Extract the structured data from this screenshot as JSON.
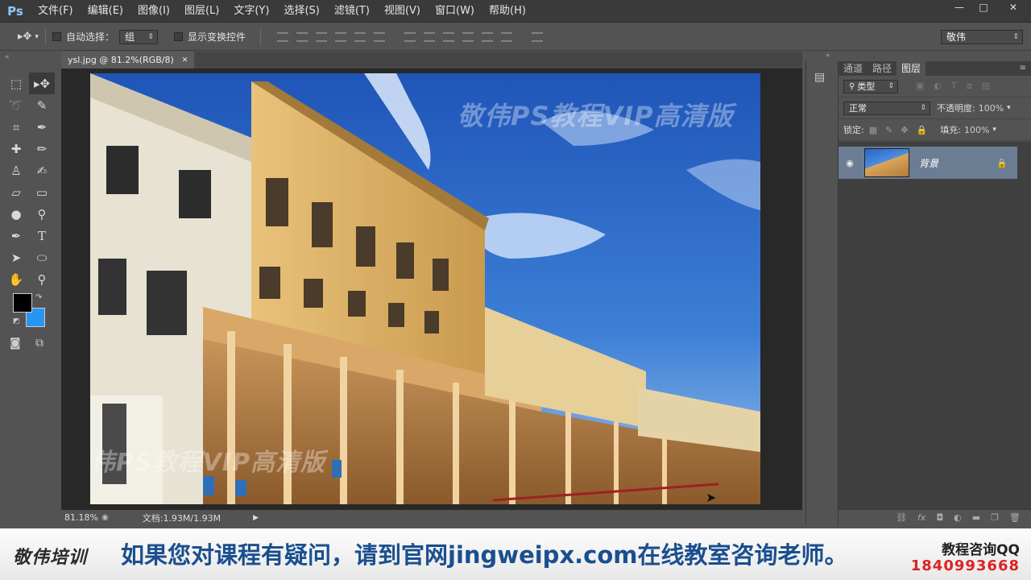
{
  "app": {
    "logo": "Ps"
  },
  "menu": [
    "文件(F)",
    "编辑(E)",
    "图像(I)",
    "图层(L)",
    "文字(Y)",
    "选择(S)",
    "滤镜(T)",
    "视图(V)",
    "窗口(W)",
    "帮助(H)"
  ],
  "window_controls": {
    "minimize": "—",
    "maximize": "□",
    "close": "✕"
  },
  "options": {
    "auto_select_label": "自动选择：",
    "auto_select_value": "组",
    "show_transform_label": "显示变换控件",
    "workspace": "敬伟"
  },
  "document": {
    "tab_title": "ysl.jpg @ 81.2%(RGB/8)",
    "close_glyph": "✕",
    "zoom": "81.18%",
    "doc_size": "文档:1.93M/1.93M",
    "watermark_top": "敬伟PS教程VIP高清版",
    "watermark_bottom": "敬伟PS教程VIP高清版"
  },
  "layers_panel": {
    "tabs": [
      "通道",
      "路径",
      "图层"
    ],
    "filter_kind": "类型",
    "blend_mode": "正常",
    "opacity_label": "不透明度:",
    "opacity_value": "100%",
    "lock_label": "锁定:",
    "fill_label": "填充:",
    "fill_value": "100%",
    "layers": [
      {
        "name": "背景",
        "visible": true,
        "locked": true
      }
    ]
  },
  "banner": {
    "logo": "敬伟培训",
    "message": "如果您对课程有疑问，请到官网jingweipx.com在线教室咨询老师。",
    "qq_label": "教程咨询QQ",
    "qq_number": "1840993668"
  },
  "colors": {
    "foreground": "#000000",
    "background": "#2894f4",
    "accent": "#1a4f8f"
  }
}
